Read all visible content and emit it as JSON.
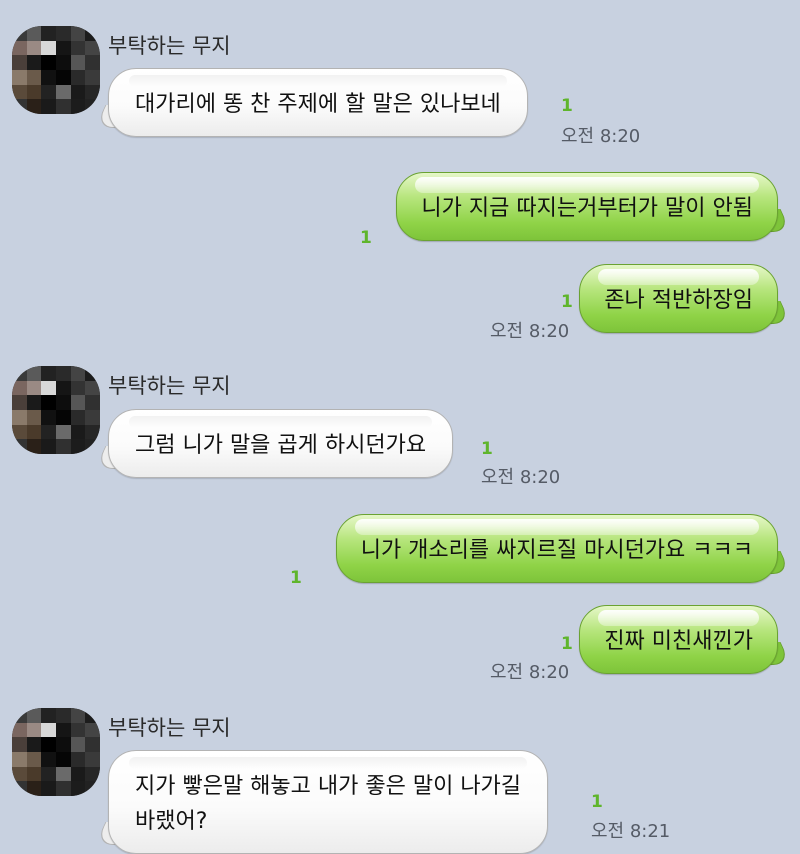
{
  "chat": {
    "sender_name": "부탁하는 무지",
    "messages": [
      {
        "text": "대가리에 똥 찬 주제에 할 말은 있나보네",
        "unread": "1",
        "time": "오전 8:20"
      },
      {
        "text": "니가 지금 따지는거부터가 말이 안됨",
        "unread": "1"
      },
      {
        "text": "존나 적반하장임",
        "unread": "1",
        "time": "오전 8:20"
      },
      {
        "text": "그럼 니가 말을 곱게 하시던가요",
        "unread": "1",
        "time": "오전 8:20"
      },
      {
        "text": "니가 개소리를 싸지르질 마시던가요 ㅋㅋㅋ",
        "unread": "1"
      },
      {
        "text": "진짜 미친새낀가",
        "unread": "1",
        "time": "오전 8:20"
      },
      {
        "text_line1": "지가 빻은말 해놓고 내가 좋은 말이 나가길",
        "text_line2": "바랬어?",
        "unread": "1",
        "time": "오전 8:21"
      }
    ]
  },
  "colors": {
    "background": "#c8d1e0",
    "outgoing_bubble": "#8fd347",
    "incoming_bubble": "#ffffff",
    "unread_count": "#5fb52c"
  }
}
